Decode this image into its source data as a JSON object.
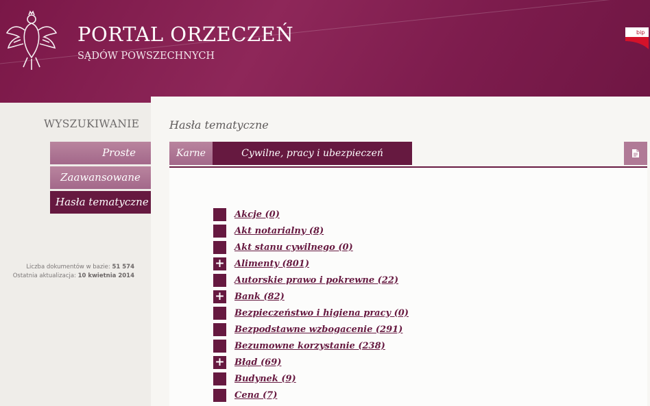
{
  "header": {
    "title": "PORTAL ORZECZEŃ",
    "subtitle": "SĄDÓW POWSZECHNYCH",
    "logo_icon": "polish-eagle-emblem",
    "bip_label": "bip",
    "brand_color": "#7a1747"
  },
  "sidebar": {
    "heading": "WYSZUKIWANIE",
    "items": [
      {
        "label": "Proste"
      },
      {
        "label": "Zaawansowane"
      },
      {
        "label": "Hasła tematyczne",
        "active": true
      }
    ],
    "stats": {
      "count_label": "Liczba dokumentów w bazie:",
      "count_value": "51 574",
      "updated_label": "Ostatnia aktualizacja:",
      "updated_value": "10 kwietnia 2014"
    }
  },
  "main": {
    "heading": "Hasła tematyczne",
    "tabs": [
      {
        "label": "Karne"
      },
      {
        "label": "Cywilne, pracy i ubezpieczeń społecznych",
        "active": true
      }
    ],
    "tab_action_icon": "document-icon",
    "active_color": "#661940",
    "topics": [
      {
        "label": "Akcje (0)",
        "expandable": false
      },
      {
        "label": "Akt notarialny (8)",
        "expandable": false
      },
      {
        "label": "Akt stanu cywilnego (0)",
        "expandable": false
      },
      {
        "label": "Alimenty (801)",
        "expandable": true
      },
      {
        "label": "Autorskie prawo i pokrewne (22)",
        "expandable": false
      },
      {
        "label": "Bank (82)",
        "expandable": true
      },
      {
        "label": "Bezpieczeństwo i higiena pracy (0)",
        "expandable": false
      },
      {
        "label": "Bezpodstawne wzbogacenie (291)",
        "expandable": false
      },
      {
        "label": "Bezumowne korzystanie (238)",
        "expandable": false
      },
      {
        "label": "Błąd (69)",
        "expandable": true
      },
      {
        "label": "Budynek (9)",
        "expandable": false
      },
      {
        "label": "Cena (7)",
        "expandable": false
      }
    ],
    "expand_glyph": "+"
  }
}
